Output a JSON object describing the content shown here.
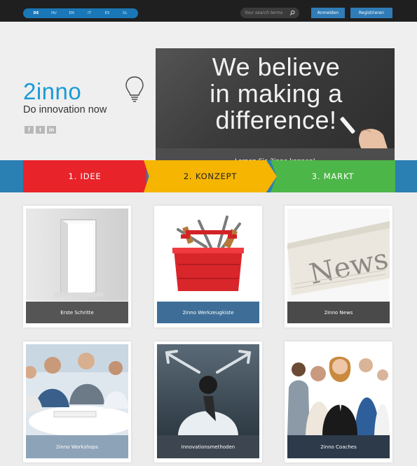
{
  "topbar": {
    "languages": [
      "DE",
      "HU",
      "EN",
      "IT",
      "ES",
      "XL"
    ],
    "active_language": "DE",
    "search": {
      "placeholder": "Your search terms"
    },
    "login_label": "Anmelden",
    "register_label": "Registrieren"
  },
  "logo": {
    "brand": "2inno",
    "tagline": "Do innovation now",
    "social": [
      "f",
      "t",
      "in"
    ]
  },
  "hero": {
    "headline_1": "We believe",
    "headline_2": "in making a",
    "headline_3": "difference!",
    "caption": "Lernen Sie 2inno kennen!",
    "slides": 2,
    "active_slide": 2
  },
  "steps": [
    {
      "label": "1. IDEE",
      "color": "#e8242a"
    },
    {
      "label": "2. KONZEPT",
      "color": "#f6b500"
    },
    {
      "label": "3. MARKT",
      "color": "#4cb648"
    }
  ],
  "tiles": [
    {
      "label": "Erste Schritte",
      "icon": "open-door-icon",
      "color": "#555555"
    },
    {
      "label": "2inno Werkzeugkiste",
      "icon": "toolbox-icon",
      "color": "#3e6e98"
    },
    {
      "label": "2inno News",
      "icon": "newspaper-icon",
      "color": "#4a4a4a"
    },
    {
      "label": "2inno Workshops",
      "icon": "workshop-people-icon",
      "color": "#8da3b8"
    },
    {
      "label": "Innovationsmethoden",
      "icon": "arrows-person-icon",
      "color": "#3d4650"
    },
    {
      "label": "2inno Coaches",
      "icon": "coaches-team-icon",
      "color": "#2c3a4a"
    }
  ]
}
